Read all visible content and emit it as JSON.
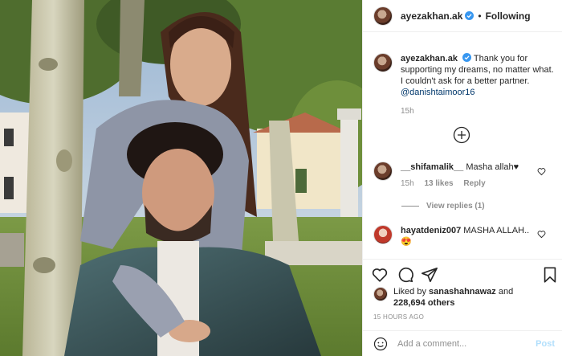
{
  "header": {
    "username": "ayezakhan.ak",
    "separator": "•",
    "follow_status": "Following"
  },
  "caption": {
    "username": "ayezakhan.ak",
    "text": "Thank you for supporting my dreams, no matter what. I couldn't ask for a better partner.",
    "mention": "@danishtaimoor16",
    "time": "15h"
  },
  "comments": [
    {
      "username": "__shifamalik__",
      "text": "Masha allah♥",
      "time": "15h",
      "likes": "13 likes",
      "reply_label": "Reply",
      "view_replies": "View replies (1)"
    },
    {
      "username": "hayatdeniz007",
      "text": "MASHA ALLAH..",
      "emoji": "😍"
    }
  ],
  "likes": {
    "prefix": "Liked by",
    "user": "sanashahnawaz",
    "and": "and",
    "others": "228,694 others"
  },
  "post_time": "15 HOURS AGO",
  "add_comment": {
    "placeholder": "Add a comment...",
    "post_label": "Post"
  },
  "colors": {
    "verified": "#3897f0",
    "link": "#00376b",
    "muted": "#8e8e8e",
    "post_disabled": "#b2dffc"
  },
  "icons": [
    "verified-badge-icon",
    "plus-circle-icon",
    "heart-icon",
    "comment-icon",
    "share-icon",
    "bookmark-icon",
    "emoji-icon"
  ]
}
